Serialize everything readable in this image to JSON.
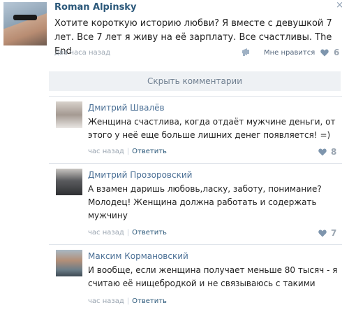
{
  "post": {
    "author": "Roman Alpinsky",
    "close_symbol": "×",
    "text": "Хотите короткую историю любви? Я вместе с девушкой 7 лет. Все 7 лет я живу на её зарплату. Все счастливы. The End",
    "time": "два часа назад",
    "like_label": "Мне нравится",
    "like_count": "6"
  },
  "hide_comments": "Скрыть комментарии",
  "comments": [
    {
      "name": "Дмитрий Швалёв",
      "text": "Женщина счастлива, когда отдаёт мужчине деньги, от этого у неё еще больше лишних денег появляется! =)",
      "time": "час назад",
      "reply": "Ответить",
      "likes": "8"
    },
    {
      "name": "Дмитрий Прозоровский",
      "text": "А взамен даришь любовь,ласку, заботу, понимание? Молодец! Женщина должна работать и содержать мужчину",
      "time": "час назад",
      "reply": "Ответить",
      "likes": "7"
    },
    {
      "name": "Максим Кормановский",
      "text": "И вообще, если женщина получает меньше 80 тысяч - я считаю её нищебродкой и не связываюсь с такими",
      "time": "час назад",
      "reply": "Ответить",
      "likes": ""
    }
  ],
  "icons": {
    "share": "megaphone-icon",
    "heart": "heart-icon",
    "close": "close-icon"
  },
  "colors": {
    "link": "#2b587a",
    "name": "#4a6f95",
    "muted": "#9aa5b1",
    "heart": "#7e95ad",
    "hide_bar_bg": "#eef1f4"
  }
}
